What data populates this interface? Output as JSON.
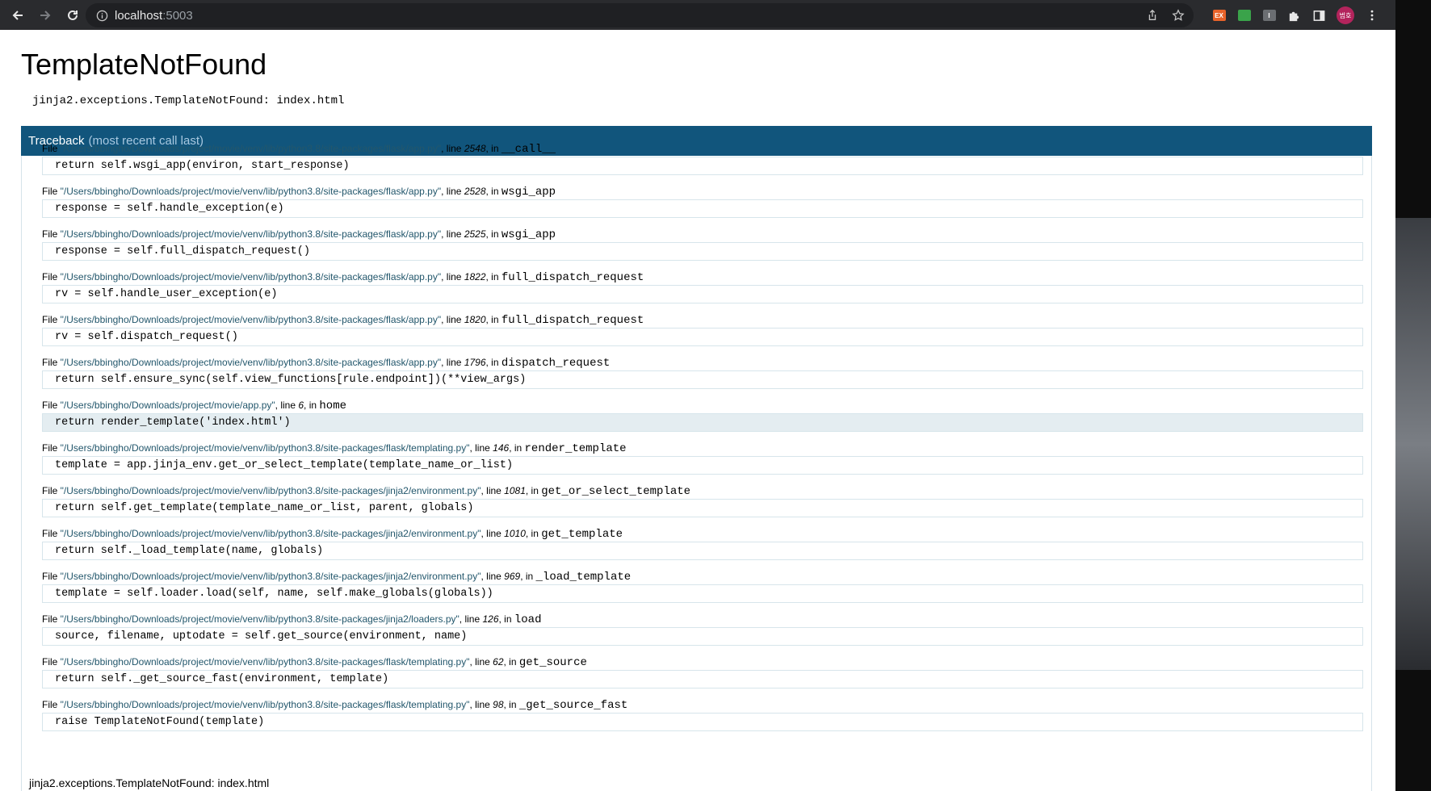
{
  "browser": {
    "url_host": "localhost",
    "url_port": ":5003",
    "extensions": [
      {
        "name": "ex-extension-icon",
        "label": "EX",
        "color": "#e8632a"
      },
      {
        "name": "green-extension-icon",
        "label": "",
        "color": "#3aa34a"
      },
      {
        "name": "grey-extension-icon",
        "label": "I",
        "color": "#6b6e72"
      }
    ],
    "avatar_label": "범호"
  },
  "page": {
    "title": "TemplateNotFound",
    "error_message": "jinja2.exceptions.TemplateNotFound: index.html",
    "traceback_label": "Traceback",
    "traceback_sub": "(most recent call last)",
    "footer_message": "jinja2.exceptions.TemplateNotFound: index.html",
    "colors": {
      "header": "#11557c",
      "path": "#23576c",
      "current_frame": "#e4edf1"
    }
  },
  "frames": [
    {
      "path": "\"/Users/bbingho/Downloads/project/movie/venv/lib/python3.8/site-packages/flask/app.py\"",
      "line": "2548",
      "func": "__call__",
      "code": "return self.wsgi_app(environ, start_response)",
      "current": false
    },
    {
      "path": "\"/Users/bbingho/Downloads/project/movie/venv/lib/python3.8/site-packages/flask/app.py\"",
      "line": "2528",
      "func": "wsgi_app",
      "code": "response = self.handle_exception(e)",
      "current": false
    },
    {
      "path": "\"/Users/bbingho/Downloads/project/movie/venv/lib/python3.8/site-packages/flask/app.py\"",
      "line": "2525",
      "func": "wsgi_app",
      "code": "response = self.full_dispatch_request()",
      "current": false
    },
    {
      "path": "\"/Users/bbingho/Downloads/project/movie/venv/lib/python3.8/site-packages/flask/app.py\"",
      "line": "1822",
      "func": "full_dispatch_request",
      "code": "rv = self.handle_user_exception(e)",
      "current": false
    },
    {
      "path": "\"/Users/bbingho/Downloads/project/movie/venv/lib/python3.8/site-packages/flask/app.py\"",
      "line": "1820",
      "func": "full_dispatch_request",
      "code": "rv = self.dispatch_request()",
      "current": false
    },
    {
      "path": "\"/Users/bbingho/Downloads/project/movie/venv/lib/python3.8/site-packages/flask/app.py\"",
      "line": "1796",
      "func": "dispatch_request",
      "code": "return self.ensure_sync(self.view_functions[rule.endpoint])(**view_args)",
      "current": false
    },
    {
      "path": "\"/Users/bbingho/Downloads/project/movie/app.py\"",
      "line": "6",
      "func": "home",
      "code": "return render_template('index.html')",
      "current": true
    },
    {
      "path": "\"/Users/bbingho/Downloads/project/movie/venv/lib/python3.8/site-packages/flask/templating.py\"",
      "line": "146",
      "func": "render_template",
      "code": "template = app.jinja_env.get_or_select_template(template_name_or_list)",
      "current": false
    },
    {
      "path": "\"/Users/bbingho/Downloads/project/movie/venv/lib/python3.8/site-packages/jinja2/environment.py\"",
      "line": "1081",
      "func": "get_or_select_template",
      "code": "return self.get_template(template_name_or_list, parent, globals)",
      "current": false
    },
    {
      "path": "\"/Users/bbingho/Downloads/project/movie/venv/lib/python3.8/site-packages/jinja2/environment.py\"",
      "line": "1010",
      "func": "get_template",
      "code": "return self._load_template(name, globals)",
      "current": false
    },
    {
      "path": "\"/Users/bbingho/Downloads/project/movie/venv/lib/python3.8/site-packages/jinja2/environment.py\"",
      "line": "969",
      "func": "_load_template",
      "code": "template = self.loader.load(self, name, self.make_globals(globals))",
      "current": false
    },
    {
      "path": "\"/Users/bbingho/Downloads/project/movie/venv/lib/python3.8/site-packages/jinja2/loaders.py\"",
      "line": "126",
      "func": "load",
      "code": "source, filename, uptodate = self.get_source(environment, name)",
      "current": false
    },
    {
      "path": "\"/Users/bbingho/Downloads/project/movie/venv/lib/python3.8/site-packages/flask/templating.py\"",
      "line": "62",
      "func": "get_source",
      "code": "return self._get_source_fast(environment, template)",
      "current": false
    },
    {
      "path": "\"/Users/bbingho/Downloads/project/movie/venv/lib/python3.8/site-packages/flask/templating.py\"",
      "line": "98",
      "func": "_get_source_fast",
      "code": "raise TemplateNotFound(template)",
      "current": false
    }
  ]
}
